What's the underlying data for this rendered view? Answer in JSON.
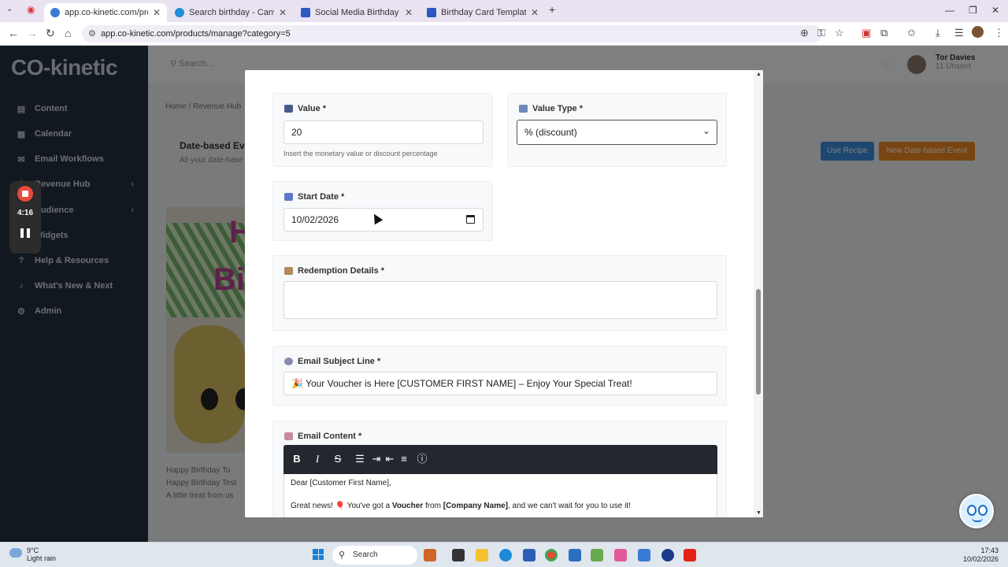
{
  "browser": {
    "tabs": [
      {
        "title": "app.co-kinetic.com/products/m",
        "fav_color": "#3a7bd5"
      },
      {
        "title": "Search birthday - Canva",
        "fav_color": "#1f8fd6"
      },
      {
        "title": "Social Media Birthday Card Te",
        "fav_color": "#2b59c3"
      },
      {
        "title": "Birthday Card Template for Co",
        "fav_color": "#2b59c3"
      }
    ],
    "url": "app.co-kinetic.com/products/manage?category=5"
  },
  "app": {
    "logo": "CO-kinetic",
    "search_placeholder": "Search...",
    "user_name": "Tor Davies",
    "user_sub": "11 Unsent",
    "sidebar": [
      {
        "label": "Content",
        "icon": "file-icon"
      },
      {
        "label": "Calendar",
        "icon": "calendar-icon"
      },
      {
        "label": "Email Workflows",
        "icon": "mail-icon"
      },
      {
        "label": "Revenue Hub",
        "icon": "dollar-icon"
      },
      {
        "label": "Audience",
        "icon": "users-icon"
      },
      {
        "label": "Widgets",
        "icon": "widget-icon"
      },
      {
        "label": "Help & Resources",
        "icon": "help-icon"
      },
      {
        "label": "What's New & Next",
        "icon": "bell-icon"
      },
      {
        "label": "Admin",
        "icon": "gear-icon"
      }
    ],
    "breadcrumb": "Home / Revenue Hub",
    "content_title": "Date-based Eve",
    "content_sub": "All your date-base",
    "btn_recipe": "Use Recipe",
    "btn_new": "New Date-based Event",
    "card_lines": [
      "Happy Birthday To",
      "Happy Birthday Test",
      "A little treat from us"
    ]
  },
  "recording": {
    "time": "4:16"
  },
  "form": {
    "value": {
      "label": "Value *",
      "value": "20",
      "help": "Insert the monetary value or discount percentage"
    },
    "value_type": {
      "label": "Value Type *",
      "selected": "% (discount)"
    },
    "start_date": {
      "label": "Start Date *",
      "value": "10/02/2026"
    },
    "redemption": {
      "label": "Redemption Details *",
      "value": ""
    },
    "subject": {
      "label": "Email Subject Line *",
      "value": "🎉 Your Voucher is Here [CUSTOMER FIRST NAME] – Enjoy Your Special Treat!"
    },
    "content": {
      "label": "Email Content *",
      "line1": "Dear [Customer First Name],",
      "line2_a": "Great news! 🎈 You've got a ",
      "line2_b": "Voucher",
      "line2_c": " from ",
      "line2_d": "[Company Name]",
      "line2_e": ", and we can't wait for you to use it!"
    }
  },
  "taskbar": {
    "temp": "9°C",
    "weather": "Light rain",
    "search": "Search",
    "time": "17:43",
    "date": "10/02/2026"
  },
  "colors": {
    "accent_blue": "#3b8fe0",
    "accent_orange": "#f08a24",
    "toolbar_dark": "#23282e"
  }
}
